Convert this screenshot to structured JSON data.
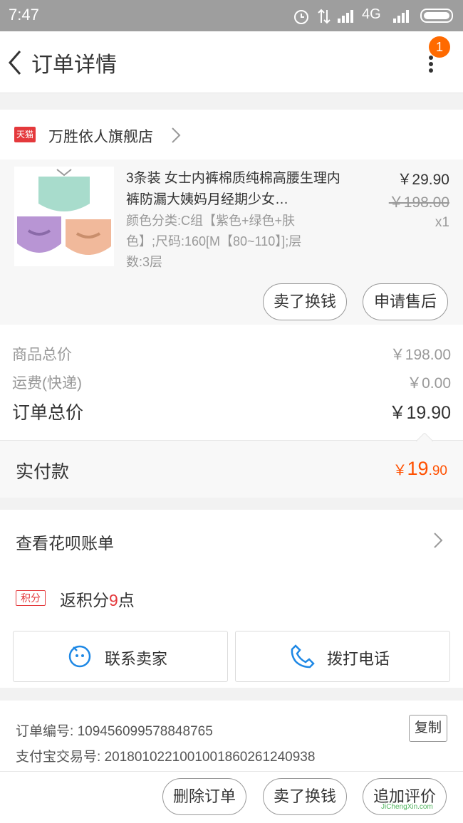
{
  "status_bar": {
    "time": "7:47",
    "network": "4G"
  },
  "nav": {
    "title": "订单详情",
    "badge_count": "1"
  },
  "store": {
    "badge": "天猫",
    "name": "万胜依人旗舰店"
  },
  "product": {
    "title": "3条装 女士内裤棉质纯棉高腰生理内裤防漏大姨妈月经期少女…",
    "sku_line1": "颜色分类:C组【紫色+绿色+肤",
    "sku_line2": "色】;尺码:160[M【80~110】];层",
    "sku_line3": "数:3层",
    "price": "￥29.90",
    "original_price": "￥198.00",
    "quantity": "x1",
    "sell_exchange_label": "卖了换钱",
    "after_sale_label": "申请售后"
  },
  "summary": {
    "goods_total_label": "商品总价",
    "goods_total_value": "￥198.00",
    "shipping_label": "运费(快递)",
    "shipping_value": "￥0.00",
    "order_total_label": "订单总价",
    "order_total_value": "￥19.90",
    "paid_label": "实付款",
    "paid_symbol": "￥",
    "paid_integer": "19",
    "paid_decimal": ".90"
  },
  "huabei": {
    "label": "查看花呗账单"
  },
  "points": {
    "badge": "积分",
    "prefix": "返积分",
    "number": "9",
    "suffix": "点"
  },
  "contact": {
    "seller_label": "联系卖家",
    "phone_label": "拨打电话"
  },
  "order_info": {
    "order_no_label": "订单编号:",
    "order_no": "109456099578848765",
    "copy_label": "复制",
    "alipay_label": "支付宝交易号:",
    "alipay_no": "2018010221001001860261240938"
  },
  "bottom_bar": {
    "delete_label": "删除订单",
    "sell_label": "卖了换钱",
    "review_label": "追加评价"
  },
  "watermark": "JiChengXin.com",
  "colors": {
    "accent": "#ff5000",
    "badge": "#ff6a00",
    "tmall": "#e4393c",
    "phone_icon": "#1e88e5"
  }
}
